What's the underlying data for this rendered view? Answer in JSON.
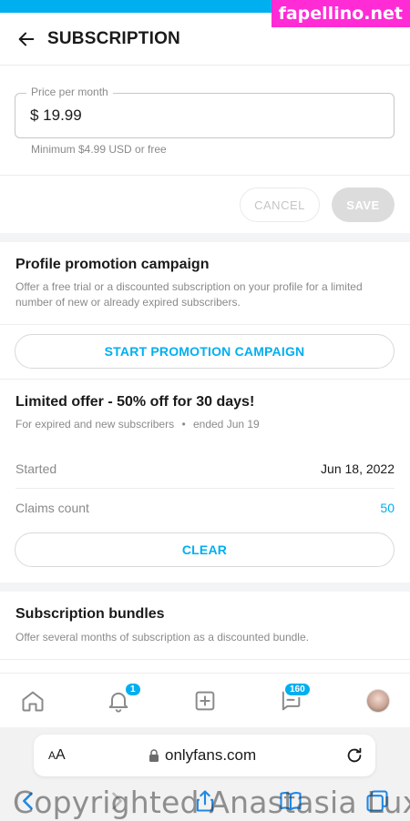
{
  "watermark_top": "fapellino.net",
  "header": {
    "title": "SUBSCRIPTION"
  },
  "price": {
    "legend": "Price per month",
    "value": "$ 19.99",
    "hint": "Minimum $4.99 USD or free"
  },
  "actions": {
    "cancel": "CANCEL",
    "save": "SAVE"
  },
  "promotion": {
    "title": "Profile promotion campaign",
    "description": "Offer a free trial or a discounted subscription on your profile for a limited number of new or already expired subscribers.",
    "button": "START PROMOTION CAMPAIGN"
  },
  "offer": {
    "title": "Limited offer - 50% off for 30 days!",
    "audience": "For expired and new subscribers",
    "ends": "ended Jun 19",
    "started_label": "Started",
    "started_value": "Jun 18, 2022",
    "claims_label": "Claims count",
    "claims_value": "50",
    "clear_button": "CLEAR"
  },
  "bundles": {
    "title": "Subscription bundles",
    "description": "Offer several months of subscription as a discounted bundle."
  },
  "navbar": {
    "items": [
      "home-icon",
      "bell-icon",
      "add-post-icon",
      "messages-icon",
      "profile-avatar"
    ],
    "notifications_badge": "1",
    "messages_badge": "160"
  },
  "browser": {
    "aa_label_small": "A",
    "aa_label_big": "A",
    "url": "onlyfans.com"
  },
  "watermark_bottom": "Copyrighted Anastasia Lux",
  "colors": {
    "accent": "#00aff0",
    "watermark": "#ff2bd5"
  }
}
